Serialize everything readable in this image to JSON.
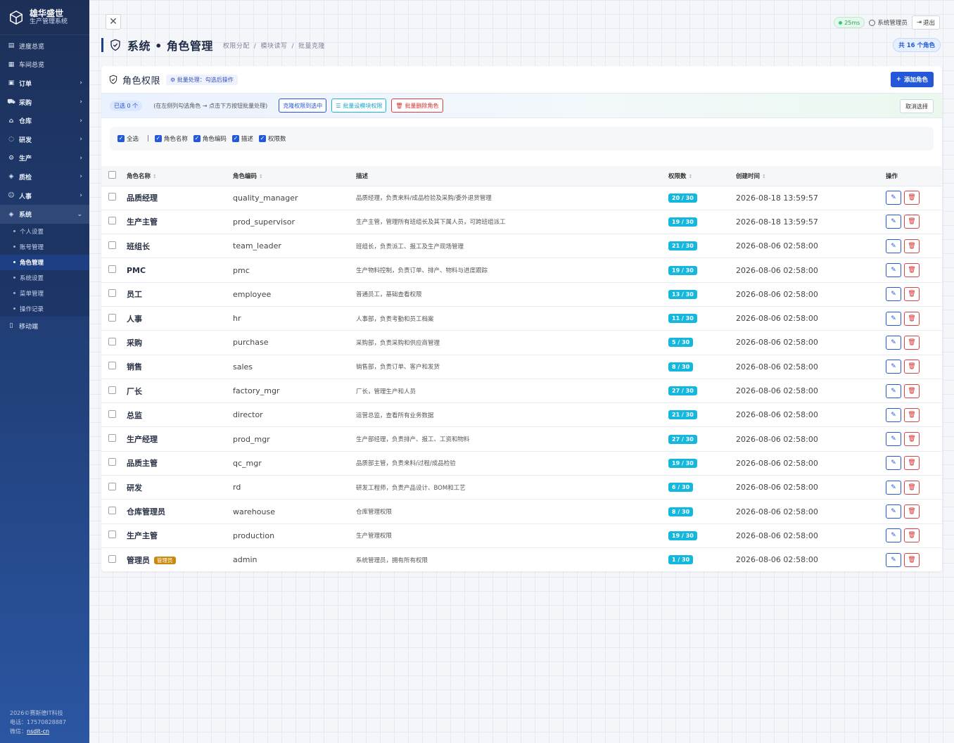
{
  "app": {
    "name": "雄华盛世",
    "subtitle": "生产管理系统"
  },
  "sidebar": {
    "top_items": [
      {
        "label": "进度总览",
        "icon": "dashboard-icon"
      },
      {
        "label": "车间总览",
        "icon": "monitor-icon"
      }
    ],
    "groups": [
      {
        "label": "订单",
        "icon": "order-icon"
      },
      {
        "label": "采购",
        "icon": "cart-icon"
      },
      {
        "label": "仓库",
        "icon": "warehouse-icon"
      },
      {
        "label": "研发",
        "icon": "bulb-icon"
      },
      {
        "label": "生产",
        "icon": "gear-icon"
      },
      {
        "label": "质检",
        "icon": "shield-icon"
      },
      {
        "label": "人事",
        "icon": "people-icon"
      }
    ],
    "system": {
      "label": "系统",
      "sub_items": [
        "个人设置",
        "账号管理",
        "角色管理",
        "系统设置",
        "菜单管理",
        "操作记录"
      ],
      "active": "角色管理"
    },
    "mobile": "移动端",
    "footer": {
      "copyright": "2026©赛斯德IT科技",
      "phone": "电话：17570828887",
      "wechat_label": "微信：",
      "wechat": "nsdit-cn"
    }
  },
  "header": {
    "ping": "25ms",
    "user": "系统管理员",
    "logout": "退出",
    "page_title": "系统 • 角色管理",
    "crumbs": [
      "权限分配",
      "模块读写",
      "批量克隆"
    ],
    "total": "共 16 个角色"
  },
  "card": {
    "title": "角色权限",
    "batch_tag": "批量处理：勾选后操作",
    "add_button": "添加角色",
    "selected": "已选 0 个",
    "hint": "(在左侧列勾选角色 → 点击下方按钮批量处理)",
    "btn_clone": "克隆权限到选中",
    "btn_batch_module": "批量设模块权限",
    "btn_batch_delete": "批量删除角色",
    "btn_clear": "取消选择",
    "columns_toggle": [
      "全选",
      "角色名称",
      "角色编码",
      "描述",
      "权限数"
    ]
  },
  "table": {
    "headers": {
      "name": "角色名称",
      "code": "角色编码",
      "desc": "描述",
      "perm": "权限数",
      "created": "创建时间",
      "ops": "操作"
    },
    "rows": [
      {
        "name": "品质经理",
        "code": "quality_manager",
        "desc": "品质经理，负责来料/成品检验及采购/委外退货管理",
        "perm": "20 / 30",
        "created": "2026-08-18 13:59:57"
      },
      {
        "name": "生产主管",
        "code": "prod_supervisor",
        "desc": "生产主管，管理所有班组长及其下属人员，可跨班组派工",
        "perm": "19 / 30",
        "created": "2026-08-18 13:59:57"
      },
      {
        "name": "班组长",
        "code": "team_leader",
        "desc": "班组长，负责派工、报工及生产现场管理",
        "perm": "21 / 30",
        "created": "2026-08-06 02:58:00"
      },
      {
        "name": "PMC",
        "code": "pmc",
        "desc": "生产物料控制，负责订单、排产、物料与进度跟踪",
        "perm": "19 / 30",
        "created": "2026-08-06 02:58:00"
      },
      {
        "name": "员工",
        "code": "employee",
        "desc": "普通员工，基础查看权限",
        "perm": "13 / 30",
        "created": "2026-08-06 02:58:00"
      },
      {
        "name": "人事",
        "code": "hr",
        "desc": "人事部，负责考勤和员工档案",
        "perm": "11 / 30",
        "created": "2026-08-06 02:58:00"
      },
      {
        "name": "采购",
        "code": "purchase",
        "desc": "采购部，负责采购和供应商管理",
        "perm": "5 / 30",
        "created": "2026-08-06 02:58:00"
      },
      {
        "name": "销售",
        "code": "sales",
        "desc": "销售部，负责订单、客户和发货",
        "perm": "8 / 30",
        "created": "2026-08-06 02:58:00"
      },
      {
        "name": "厂长",
        "code": "factory_mgr",
        "desc": "厂长，管理生产和人员",
        "perm": "27 / 30",
        "created": "2026-08-06 02:58:00"
      },
      {
        "name": "总监",
        "code": "director",
        "desc": "运营总监，查看所有业务数据",
        "perm": "21 / 30",
        "created": "2026-08-06 02:58:00"
      },
      {
        "name": "生产经理",
        "code": "prod_mgr",
        "desc": "生产部经理，负责排产、报工、工资和物料",
        "perm": "27 / 30",
        "created": "2026-08-06 02:58:00"
      },
      {
        "name": "品质主管",
        "code": "qc_mgr",
        "desc": "品质部主管，负责来料/过程/成品检验",
        "perm": "19 / 30",
        "created": "2026-08-06 02:58:00"
      },
      {
        "name": "研发",
        "code": "rd",
        "desc": "研发工程师，负责产品设计、BOM和工艺",
        "perm": "6 / 30",
        "created": "2026-08-06 02:58:00"
      },
      {
        "name": "仓库管理员",
        "code": "warehouse",
        "desc": "仓库管理权限",
        "perm": "8 / 30",
        "created": "2026-08-06 02:58:00"
      },
      {
        "name": "生产主管",
        "code": "production",
        "desc": "生产管理权限",
        "perm": "19 / 30",
        "created": "2026-08-06 02:58:00"
      },
      {
        "name": "管理员",
        "code": "admin",
        "desc": "系统管理员，拥有所有权限",
        "perm": "1 / 30",
        "created": "2026-08-06 02:58:00",
        "badge": "管理员"
      }
    ]
  }
}
